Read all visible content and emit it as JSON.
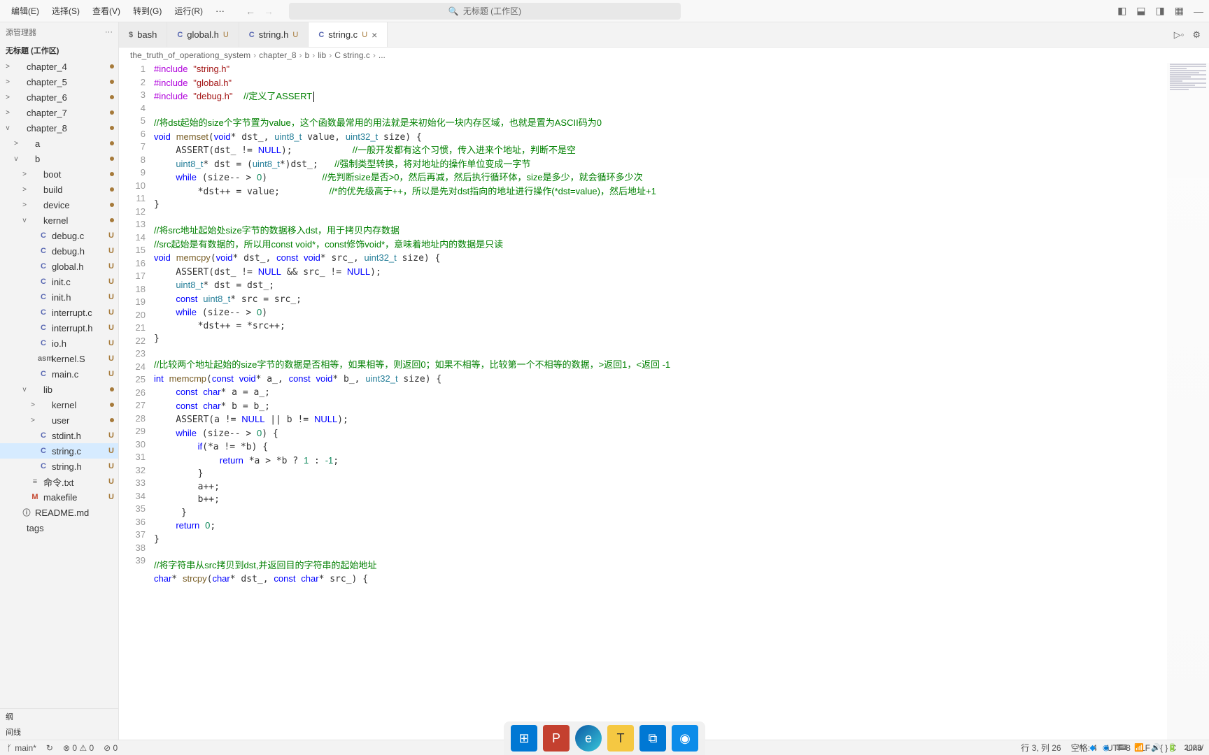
{
  "menu": {
    "items": [
      "编辑(E)",
      "选择(S)",
      "查看(V)",
      "转到(G)",
      "运行(R)"
    ],
    "search": "无标题 (工作区)"
  },
  "sidebar": {
    "header": "源管理器",
    "title": "无标题 (工作区)",
    "tree": [
      {
        "indent": 0,
        "chev": ">",
        "icon": "",
        "label": "chapter_4",
        "badge": "",
        "dot": true
      },
      {
        "indent": 0,
        "chev": ">",
        "icon": "",
        "label": "chapter_5",
        "badge": "",
        "dot": true
      },
      {
        "indent": 0,
        "chev": ">",
        "icon": "",
        "label": "chapter_6",
        "badge": "",
        "dot": true
      },
      {
        "indent": 0,
        "chev": ">",
        "icon": "",
        "label": "chapter_7",
        "badge": "",
        "dot": true
      },
      {
        "indent": 0,
        "chev": "v",
        "icon": "",
        "label": "chapter_8",
        "badge": "",
        "dot": true
      },
      {
        "indent": 1,
        "chev": ">",
        "icon": "",
        "label": "a",
        "badge": "",
        "dot": true
      },
      {
        "indent": 1,
        "chev": "v",
        "icon": "",
        "label": "b",
        "badge": "",
        "dot": true
      },
      {
        "indent": 2,
        "chev": ">",
        "icon": "",
        "label": "boot",
        "badge": "",
        "dot": true
      },
      {
        "indent": 2,
        "chev": ">",
        "icon": "",
        "label": "build",
        "badge": "",
        "dot": true
      },
      {
        "indent": 2,
        "chev": ">",
        "icon": "",
        "label": "device",
        "badge": "",
        "dot": true
      },
      {
        "indent": 2,
        "chev": "v",
        "icon": "",
        "label": "kernel",
        "badge": "",
        "dot": true
      },
      {
        "indent": 3,
        "chev": "",
        "icon": "C",
        "iclass": "c",
        "label": "debug.c",
        "badge": "U"
      },
      {
        "indent": 3,
        "chev": "",
        "icon": "C",
        "iclass": "c",
        "label": "debug.h",
        "badge": "U"
      },
      {
        "indent": 3,
        "chev": "",
        "icon": "C",
        "iclass": "c",
        "label": "global.h",
        "badge": "U"
      },
      {
        "indent": 3,
        "chev": "",
        "icon": "C",
        "iclass": "c",
        "label": "init.c",
        "badge": "U"
      },
      {
        "indent": 3,
        "chev": "",
        "icon": "C",
        "iclass": "c",
        "label": "init.h",
        "badge": "U"
      },
      {
        "indent": 3,
        "chev": "",
        "icon": "C",
        "iclass": "c",
        "label": "interrupt.c",
        "badge": "U"
      },
      {
        "indent": 3,
        "chev": "",
        "icon": "C",
        "iclass": "c",
        "label": "interrupt.h",
        "badge": "U"
      },
      {
        "indent": 3,
        "chev": "",
        "icon": "C",
        "iclass": "c",
        "label": "io.h",
        "badge": "U"
      },
      {
        "indent": 3,
        "chev": "",
        "icon": "asm",
        "iclass": "txt",
        "label": "kernel.S",
        "badge": "U"
      },
      {
        "indent": 3,
        "chev": "",
        "icon": "C",
        "iclass": "c",
        "label": "main.c",
        "badge": "U"
      },
      {
        "indent": 2,
        "chev": "v",
        "icon": "",
        "label": "lib",
        "badge": "",
        "dot": true
      },
      {
        "indent": 3,
        "chev": ">",
        "icon": "",
        "label": "kernel",
        "badge": "",
        "dot": true
      },
      {
        "indent": 3,
        "chev": ">",
        "icon": "",
        "label": "user",
        "badge": "",
        "dot": true
      },
      {
        "indent": 3,
        "chev": "",
        "icon": "C",
        "iclass": "c",
        "label": "stdint.h",
        "badge": "U"
      },
      {
        "indent": 3,
        "chev": "",
        "icon": "C",
        "iclass": "c",
        "label": "string.c",
        "badge": "U",
        "sel": true
      },
      {
        "indent": 3,
        "chev": "",
        "icon": "C",
        "iclass": "c",
        "label": "string.h",
        "badge": "U"
      },
      {
        "indent": 2,
        "chev": "",
        "icon": "≡",
        "iclass": "txt",
        "label": "命令.txt",
        "badge": "U"
      },
      {
        "indent": 2,
        "chev": "",
        "icon": "M",
        "iclass": "m",
        "label": "makefile",
        "badge": "U"
      },
      {
        "indent": 1,
        "chev": "",
        "icon": "ⓘ",
        "iclass": "txt",
        "label": "README.md",
        "badge": ""
      },
      {
        "indent": 0,
        "chev": "",
        "icon": "",
        "label": "tags",
        "badge": ""
      }
    ],
    "bottom": [
      "纲",
      "间线"
    ]
  },
  "tabs": [
    {
      "icon": "$",
      "iclass": "sh",
      "label": "bash",
      "u": "",
      "active": false
    },
    {
      "icon": "C",
      "iclass": "c",
      "label": "global.h",
      "u": "U",
      "active": false
    },
    {
      "icon": "C",
      "iclass": "c",
      "label": "string.h",
      "u": "U",
      "active": false
    },
    {
      "icon": "C",
      "iclass": "c",
      "label": "string.c",
      "u": "U",
      "active": true,
      "close": true
    }
  ],
  "crumbs": [
    "the_truth_of_operationg_system",
    "chapter_8",
    "b",
    "lib",
    "C string.c",
    "..."
  ],
  "status": {
    "left": {
      "branch": "main*",
      "sync": "↻",
      "err": "⊗ 0 ⚠ 0",
      "radio": "⊘ 0"
    },
    "right": {
      "pos": "行 3, 列 26",
      "spaces": "空格: 4",
      "enc": "UTF-8",
      "eol": "LF",
      "lang": "{ } C",
      "os": "Linu"
    }
  },
  "tray": {
    "time": "2023/"
  }
}
